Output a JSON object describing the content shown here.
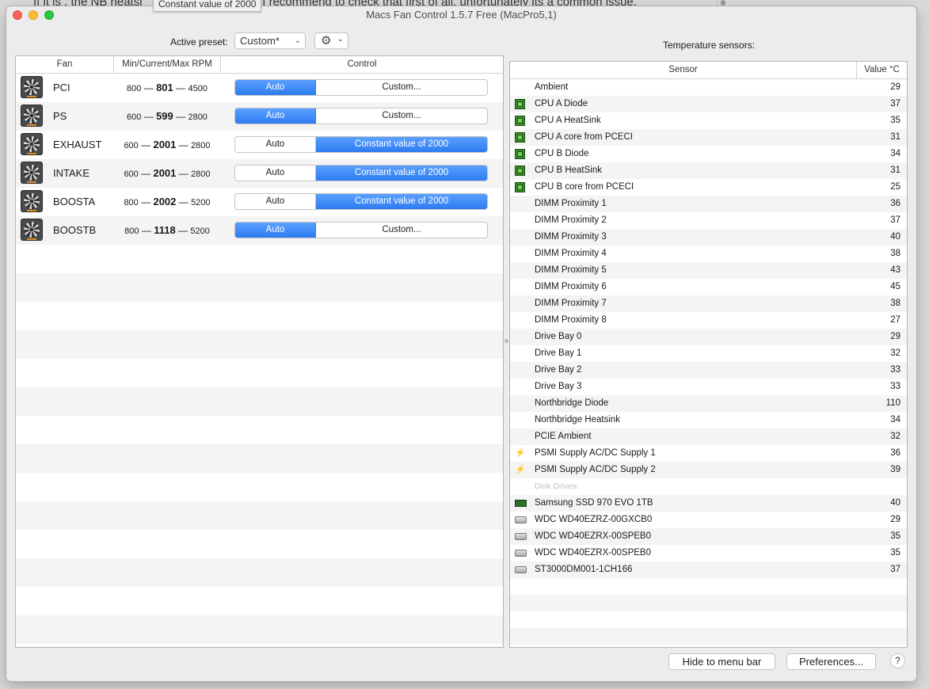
{
  "background": {
    "text": "If it is , the NB heatsi",
    "text2": "h. I recommend to check that first of all. unfortunately its a common issue."
  },
  "tooltip": "Constant value of 2000",
  "window": {
    "title": "Macs Fan Control 1.5.7 Free (MacPro5,1)"
  },
  "toolbar": {
    "active_preset_label": "Active preset:",
    "preset_value": "Custom*",
    "gear_icon": "gear-icon"
  },
  "fans": {
    "headers": {
      "fan": "Fan",
      "rpm": "Min/Current/Max RPM",
      "control": "Control"
    },
    "rows": [
      {
        "name": "PCI",
        "min": "800",
        "current": "801",
        "max": "4500",
        "auto": "Auto",
        "custom": "Custom...",
        "selected": "auto"
      },
      {
        "name": "PS",
        "min": "600",
        "current": "599",
        "max": "2800",
        "auto": "Auto",
        "custom": "Custom...",
        "selected": "auto"
      },
      {
        "name": "EXHAUST",
        "min": "600",
        "current": "2001",
        "max": "2800",
        "auto": "Auto",
        "custom": "Constant value of 2000",
        "selected": "custom"
      },
      {
        "name": "INTAKE",
        "min": "600",
        "current": "2001",
        "max": "2800",
        "auto": "Auto",
        "custom": "Constant value of 2000",
        "selected": "custom"
      },
      {
        "name": "BOOSTA",
        "min": "800",
        "current": "2002",
        "max": "5200",
        "auto": "Auto",
        "custom": "Constant value of 2000",
        "selected": "custom"
      },
      {
        "name": "BOOSTB",
        "min": "800",
        "current": "1118",
        "max": "5200",
        "auto": "Auto",
        "custom": "Custom...",
        "selected": "auto"
      }
    ]
  },
  "sensors": {
    "title": "Temperature sensors:",
    "headers": {
      "sensor": "Sensor",
      "value": "Value °C"
    },
    "rows": [
      {
        "icon": "",
        "name": "Ambient",
        "value": "29"
      },
      {
        "icon": "cpu-chip-icon",
        "name": "CPU A Diode",
        "value": "37"
      },
      {
        "icon": "cpu-chip-icon",
        "name": "CPU A HeatSink",
        "value": "35"
      },
      {
        "icon": "cpu-chip-icon",
        "name": "CPU A core from PCECI",
        "value": "31"
      },
      {
        "icon": "cpu-chip-icon",
        "name": "CPU B Diode",
        "value": "34"
      },
      {
        "icon": "cpu-chip-icon",
        "name": "CPU B HeatSink",
        "value": "31"
      },
      {
        "icon": "cpu-chip-icon",
        "name": "CPU B core from PCECI",
        "value": "25"
      },
      {
        "icon": "",
        "name": "DIMM Proximity 1",
        "value": "36"
      },
      {
        "icon": "",
        "name": "DIMM Proximity 2",
        "value": "37"
      },
      {
        "icon": "",
        "name": "DIMM Proximity 3",
        "value": "40"
      },
      {
        "icon": "",
        "name": "DIMM Proximity 4",
        "value": "38"
      },
      {
        "icon": "",
        "name": "DIMM Proximity 5",
        "value": "43"
      },
      {
        "icon": "",
        "name": "DIMM Proximity 6",
        "value": "45"
      },
      {
        "icon": "",
        "name": "DIMM Proximity 7",
        "value": "38"
      },
      {
        "icon": "",
        "name": "DIMM Proximity 8",
        "value": "27"
      },
      {
        "icon": "",
        "name": "Drive Bay 0",
        "value": "29"
      },
      {
        "icon": "",
        "name": "Drive Bay 1",
        "value": "32"
      },
      {
        "icon": "",
        "name": "Drive Bay 2",
        "value": "33"
      },
      {
        "icon": "",
        "name": "Drive Bay 3",
        "value": "33"
      },
      {
        "icon": "",
        "name": "Northbridge Diode",
        "value": "110"
      },
      {
        "icon": "",
        "name": "Northbridge Heatsink",
        "value": "34"
      },
      {
        "icon": "",
        "name": "PCIE Ambient",
        "value": "32"
      },
      {
        "icon": "power-bolt-icon",
        "name": "PSMI Supply AC/DC Supply 1",
        "value": "36"
      },
      {
        "icon": "power-bolt-icon",
        "name": "PSMI Supply AC/DC Supply 2",
        "value": "39"
      }
    ],
    "disk_group_label": "Disk Drives:",
    "disks": [
      {
        "icon": "ssd-icon",
        "name": "Samsung SSD 970 EVO 1TB",
        "value": "40"
      },
      {
        "icon": "hard-drive-icon",
        "name": "WDC WD40EZRZ-00GXCB0",
        "value": "29"
      },
      {
        "icon": "hard-drive-icon",
        "name": "WDC WD40EZRX-00SPEB0",
        "value": "35"
      },
      {
        "icon": "hard-drive-icon",
        "name": "WDC WD40EZRX-00SPEB0",
        "value": "35"
      },
      {
        "icon": "hard-drive-icon",
        "name": "ST3000DM001-1CH166",
        "value": "37"
      }
    ]
  },
  "footer": {
    "hide_label": "Hide to menu bar",
    "prefs_label": "Preferences...",
    "help_label": "?"
  },
  "colors": {
    "accent": "#2d7bf1",
    "close": "#fc5f57",
    "minimize": "#fdbc2e",
    "maximize": "#28c840"
  }
}
